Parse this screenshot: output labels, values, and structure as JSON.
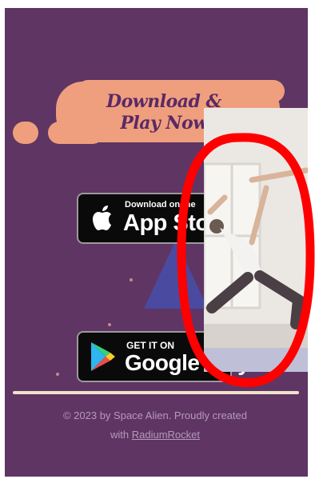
{
  "banner": {
    "line1": "Download &",
    "line2": "Play Now"
  },
  "app_store": {
    "small": "Download on the",
    "big": "App Store"
  },
  "google_play": {
    "small": "GET IT ON",
    "big": "Google Play"
  },
  "footer": {
    "text": "© 2023 by Space Alien. Proudly created",
    "with": "with",
    "link": "RadiumRocket"
  },
  "colors": {
    "background": "#5f3564",
    "accent": "#ef9f7d",
    "annotation": "#ff0000"
  },
  "icons": [
    "apple-icon",
    "google-play-icon"
  ]
}
